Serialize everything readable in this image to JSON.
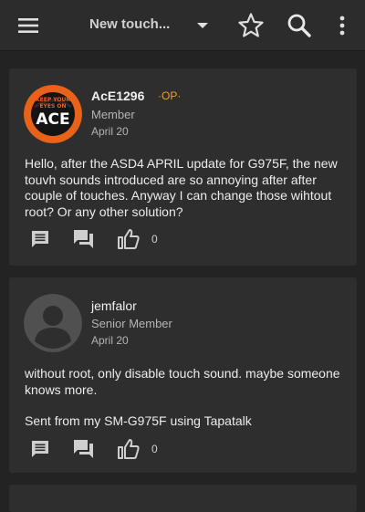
{
  "topbar": {
    "title": "New touch...",
    "icons": [
      "menu-icon",
      "chevron-down-icon",
      "star-icon",
      "search-icon",
      "more-vertical-icon"
    ]
  },
  "posts": [
    {
      "username": "AcE1296",
      "op_badge": "·OP·",
      "rank": "Member",
      "date": "April 20",
      "avatar": "keep-calm-ace-avatar",
      "avatar_text": [
        "KEEP YOUR",
        "EYES ON",
        "ACE"
      ],
      "body": [
        "Hello, after the ASD4 APRIL update for G975F, the new touvh sounds introduced are so annoying after after couple of touches. Anyway I can change those wihtout root? Or any other solution?"
      ],
      "like_count": "0"
    },
    {
      "username": "jemfalor",
      "rank": "Senior Member",
      "date": "April 20",
      "avatar": "default-user-avatar",
      "body": [
        "without root, only disable touch sound. maybe someone knows more.",
        "Sent from my SM-G975F using Tapatalk"
      ],
      "like_count": "0"
    }
  ],
  "colors": {
    "background": "#232323",
    "card": "#2e2e2e",
    "topbar": "#2c2c2c",
    "op_accent": "#f0a020",
    "avatar_orange": "#e8621a"
  }
}
